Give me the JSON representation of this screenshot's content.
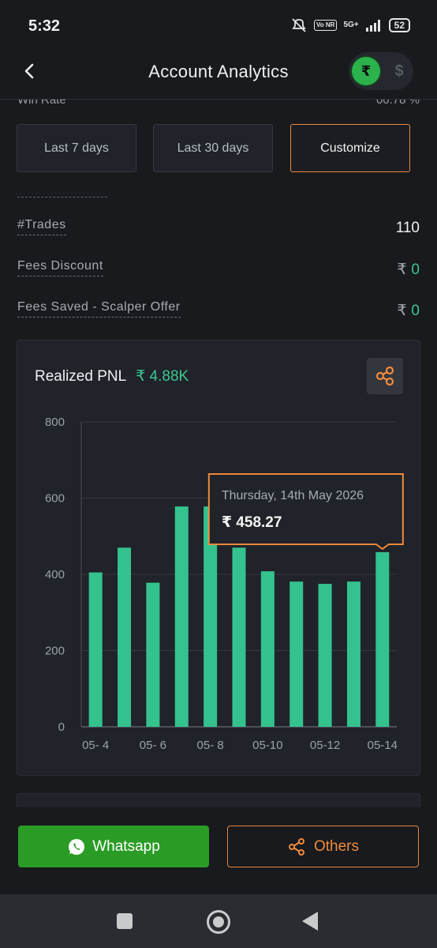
{
  "status_bar": {
    "time": "5:32",
    "network": "5G+",
    "volte": "Vo NR",
    "battery": "52"
  },
  "header": {
    "title": "Account Analytics",
    "currency_selected": "₹",
    "currency_other": "$"
  },
  "clipped_row": {
    "label": "Win Rate",
    "value": "00.78 %"
  },
  "range_buttons": [
    {
      "label": "Last 7 days",
      "active": false
    },
    {
      "label": "Last 30 days",
      "active": false
    },
    {
      "label": "Customize",
      "active": true
    }
  ],
  "stats": [
    {
      "label": "#Trades",
      "value": "110"
    },
    {
      "label": "Fees Discount",
      "currency": "₹",
      "value": "0"
    },
    {
      "label": "Fees Saved - Scalper Offer",
      "currency": "₹",
      "value": "0"
    }
  ],
  "pnl_card": {
    "title": "Realized PNL",
    "value": "₹ 4.88K",
    "share_icon": "share-icon"
  },
  "chart_data": {
    "type": "bar",
    "title": "Realized PNL",
    "categories": [
      "05- 4",
      "05- 5",
      "05- 6",
      "05- 7",
      "05- 8",
      "05- 9",
      "05-10",
      "05-11",
      "05-12",
      "05-13",
      "05-14"
    ],
    "tick_labels_shown": [
      "05- 4",
      "05- 6",
      "05- 8",
      "05-10",
      "05-12",
      "05-14"
    ],
    "values": [
      405,
      470,
      378,
      578,
      578,
      470,
      408,
      381,
      375,
      381,
      458.27
    ],
    "ylim": [
      0,
      800
    ],
    "yticks": [
      0,
      200,
      400,
      600,
      800
    ],
    "grid": true,
    "bar_color": "#34c28f",
    "tooltip": {
      "index": 10,
      "title": "Thursday, 14th May 2026",
      "currency": "₹",
      "value": "458.27"
    }
  },
  "actions": {
    "whatsapp_label": "Whatsapp",
    "others_label": "Others"
  },
  "colors": {
    "accent_orange": "#f08a3c",
    "profit_green": "#3ec793",
    "whatsapp_green": "#2a9c25",
    "background": "#181a1e"
  }
}
